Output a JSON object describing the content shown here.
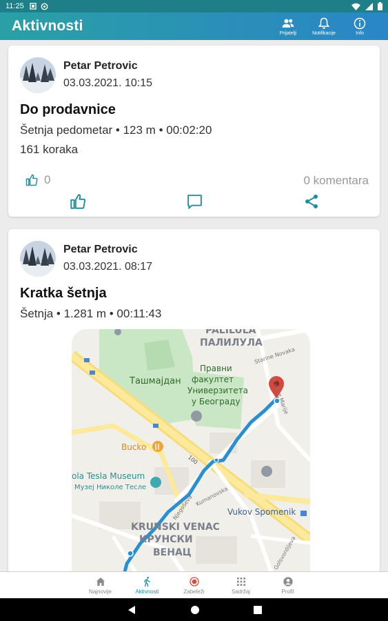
{
  "status": {
    "time": "11:25"
  },
  "appbar": {
    "title": "Aktivnosti",
    "actions": [
      {
        "label": "Prijatelji",
        "icon": "people-icon"
      },
      {
        "label": "Notifikacije",
        "icon": "bell-icon"
      },
      {
        "label": "Info",
        "icon": "info-icon"
      }
    ]
  },
  "posts": [
    {
      "user": "Petar Petrovic",
      "date": "03.03.2021. 10:15",
      "title": "Do prodavnice",
      "meta": "Šetnja pedometar • 123 m • 00:02:20",
      "steps": "161 koraka",
      "likes": "0",
      "comments": "0 komentara"
    },
    {
      "user": "Petar Petrovic",
      "date": "03.03.2021. 08:17",
      "title": "Kratka šetnja",
      "meta": "Šetnja • 1.281 m • 00:11:43",
      "map": {
        "labels": {
          "palilula": "PALILULA",
          "palilula_cyr": "ПАЛИЛУЛА",
          "tasmajdan": "Ташмајдан",
          "faculty1": "Правни",
          "faculty2": "факултет",
          "faculty3": "Универзитета",
          "faculty4": "у Београду",
          "bucko": "Bucko",
          "tesla": "ola Tesla Museum",
          "tesla_cyr": "Музеј Николе Тесле",
          "vukov": "Vukov Spomenik",
          "krunski": "KRUNSKI VENAC",
          "krunski_cyr1": "КРУНСКИ",
          "krunski_cyr2": "ВЕНАЦ",
          "road_100": "100",
          "staro_novaka": "Starine Novaka",
          "kraljice": "Kraljice Marije",
          "kumanovska": "Kumanovska",
          "njegoseva": "Njegoševa",
          "golsvordijeva": "Golsvordijeva"
        }
      }
    }
  ],
  "bottom_nav": [
    {
      "label": "Najnovije",
      "icon": "home-icon"
    },
    {
      "label": "Aktivnosti",
      "icon": "walk-icon",
      "active": true
    },
    {
      "label": "Zabeleži",
      "icon": "record-icon"
    },
    {
      "label": "Sadržaj",
      "icon": "grid-icon"
    },
    {
      "label": "Profil",
      "icon": "profile-icon"
    }
  ],
  "colors": {
    "accent": "#1f8fa0",
    "route": "#2a8fd0",
    "pin": "#d9473b"
  }
}
